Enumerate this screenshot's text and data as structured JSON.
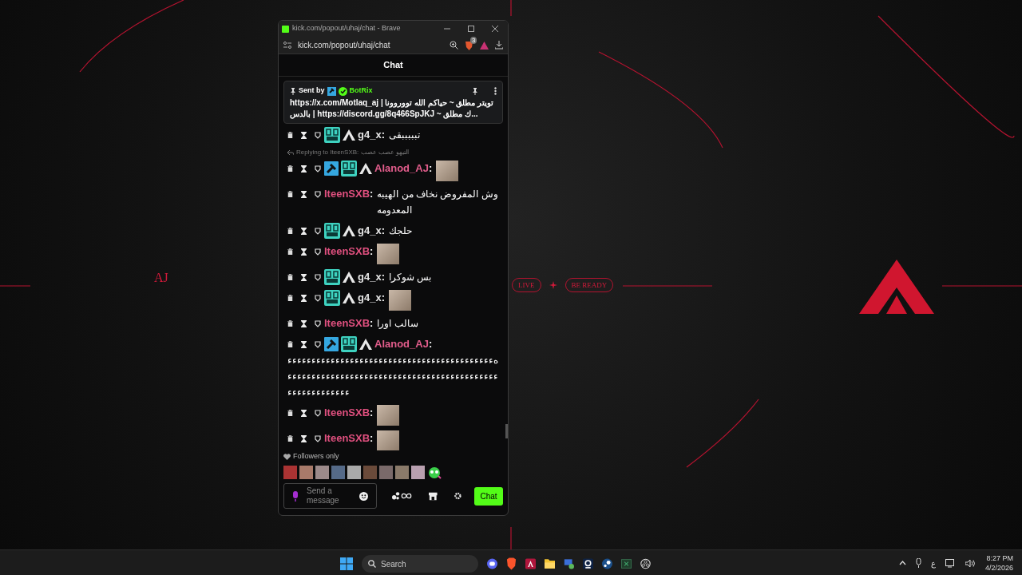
{
  "wallpaper": {
    "tag": "AJ",
    "live_pill": "LIVE",
    "ready_pill": "BE READY"
  },
  "browser": {
    "title": "kick.com/popout/uhaj/chat - Brave",
    "address": "kick.com/popout/uhaj/chat",
    "shields_count": "3"
  },
  "chat": {
    "header": "Chat",
    "pinned": {
      "sent_by": "Sent by",
      "bot": "BotRix",
      "lines": [
        "تويتر مطلق ~ حياكم الله تووروونا | https://x.com/Motlaq_aj",
        "...ك مطلق ~ https://discord.gg/8q466SpJKJ | بالدس"
      ]
    },
    "messages": [
      {
        "badges": [
          {
            "kind": "og"
          },
          {
            "kind": "apex"
          }
        ],
        "user": "g4_x",
        "color": "#e5e5e5",
        "colon": ":",
        "kind": "text",
        "text": "تبببببقى"
      },
      {
        "reply": "Replying to IteenSXB: التيهو عصب عصب",
        "badges": [
          {
            "kind": "mod"
          },
          {
            "kind": "og"
          },
          {
            "kind": "apex"
          }
        ],
        "user": "Alanod_AJ",
        "color": "#e35d8c",
        "colon": ":",
        "kind": "emote"
      },
      {
        "user": "IteenSXB",
        "color": "#e0507f",
        "colon": ":",
        "kind": "text",
        "text": "وش المفروض نخاف من الهيبه المعدومه"
      },
      {
        "badges": [
          {
            "kind": "og"
          },
          {
            "kind": "apex"
          }
        ],
        "user": "g4_x",
        "color": "#e5e5e5",
        "colon": ":",
        "kind": "text",
        "text": "حلجك"
      },
      {
        "user": "IteenSXB",
        "color": "#e0507f",
        "colon": ":",
        "kind": "emote"
      },
      {
        "badges": [
          {
            "kind": "og"
          },
          {
            "kind": "apex"
          }
        ],
        "user": "g4_x",
        "color": "#e5e5e5",
        "colon": ":",
        "kind": "text",
        "text": "بس شوكرا"
      },
      {
        "badges": [
          {
            "kind": "og"
          },
          {
            "kind": "apex"
          }
        ],
        "user": "g4_x",
        "color": "#e5e5e5",
        "colon": ":",
        "kind": "emote"
      },
      {
        "user": "IteenSXB",
        "color": "#e0507f",
        "colon": ":",
        "kind": "text",
        "text": "سالب اورا"
      },
      {
        "badges": [
          {
            "kind": "mod"
          },
          {
            "kind": "og"
          },
          {
            "kind": "apex"
          }
        ],
        "user": "Alanod_AJ",
        "color": "#e35d8c",
        "colon": ":",
        "kind": "text",
        "text": "هءءءءءءءءءءءءءءءءءءءءءءءءءءءءءءءءءءءءءءءءءءءءءءءءءءءءءءءءءءءءءءءءءءءءءءءءءءءءءءءءءءءءءءءءءءءءءءءءءءءء"
      },
      {
        "user": "IteenSXB",
        "color": "#e0507f",
        "colon": ":",
        "kind": "emote"
      },
      {
        "user": "IteenSXB",
        "color": "#e0507f",
        "colon": ":",
        "kind": "emote"
      }
    ],
    "mode": "Followers only",
    "input": {
      "placeholder": "Send a message"
    },
    "send": "Chat"
  },
  "taskbar": {
    "search": "Search",
    "apps": [
      {
        "kind": "discord"
      },
      {
        "kind": "brave"
      },
      {
        "kind": "kick"
      },
      {
        "kind": "folder"
      },
      {
        "kind": "network"
      },
      {
        "kind": "webcam"
      },
      {
        "kind": "steam"
      },
      {
        "kind": "excel"
      },
      {
        "kind": "obs"
      }
    ],
    "lang": "ع",
    "time": "8:27 PM",
    "date": "4/2/2026"
  }
}
